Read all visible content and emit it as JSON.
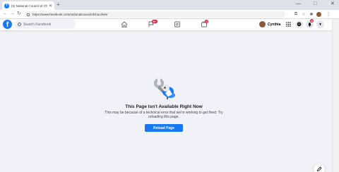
{
  "browser": {
    "tab_title": "(5) National Council of Churches",
    "tab_favicon": "f",
    "new_tab": "+",
    "url": "https://www.facebook.com/nationalcouncilofchurches/",
    "window_controls": {
      "minimize": "—",
      "maximize": "□",
      "close": "✕"
    },
    "nav": {
      "back": "←",
      "forward": "→",
      "reload": "↻"
    }
  },
  "fb_header": {
    "logo": "f",
    "search": {
      "placeholder": "Search Facebook",
      "value": ""
    },
    "nav_items": [
      {
        "icon": "home-icon",
        "badge": ""
      },
      {
        "icon": "flag-icon",
        "badge": "9+"
      },
      {
        "icon": "marketplace-icon",
        "badge": ""
      },
      {
        "icon": "groups-icon",
        "badge": "2"
      }
    ],
    "user_name": "Cynthia",
    "notifications_badge": "8"
  },
  "error": {
    "title": "This Page Isn't Available Right Now",
    "message": "This may be because of a technical error that we're working to get fixed. Try reloading this page.",
    "button": "Reload Page"
  },
  "colors": {
    "brand": "#1877f2",
    "badge": "#e41e3f",
    "background": "#f0f2f5"
  }
}
